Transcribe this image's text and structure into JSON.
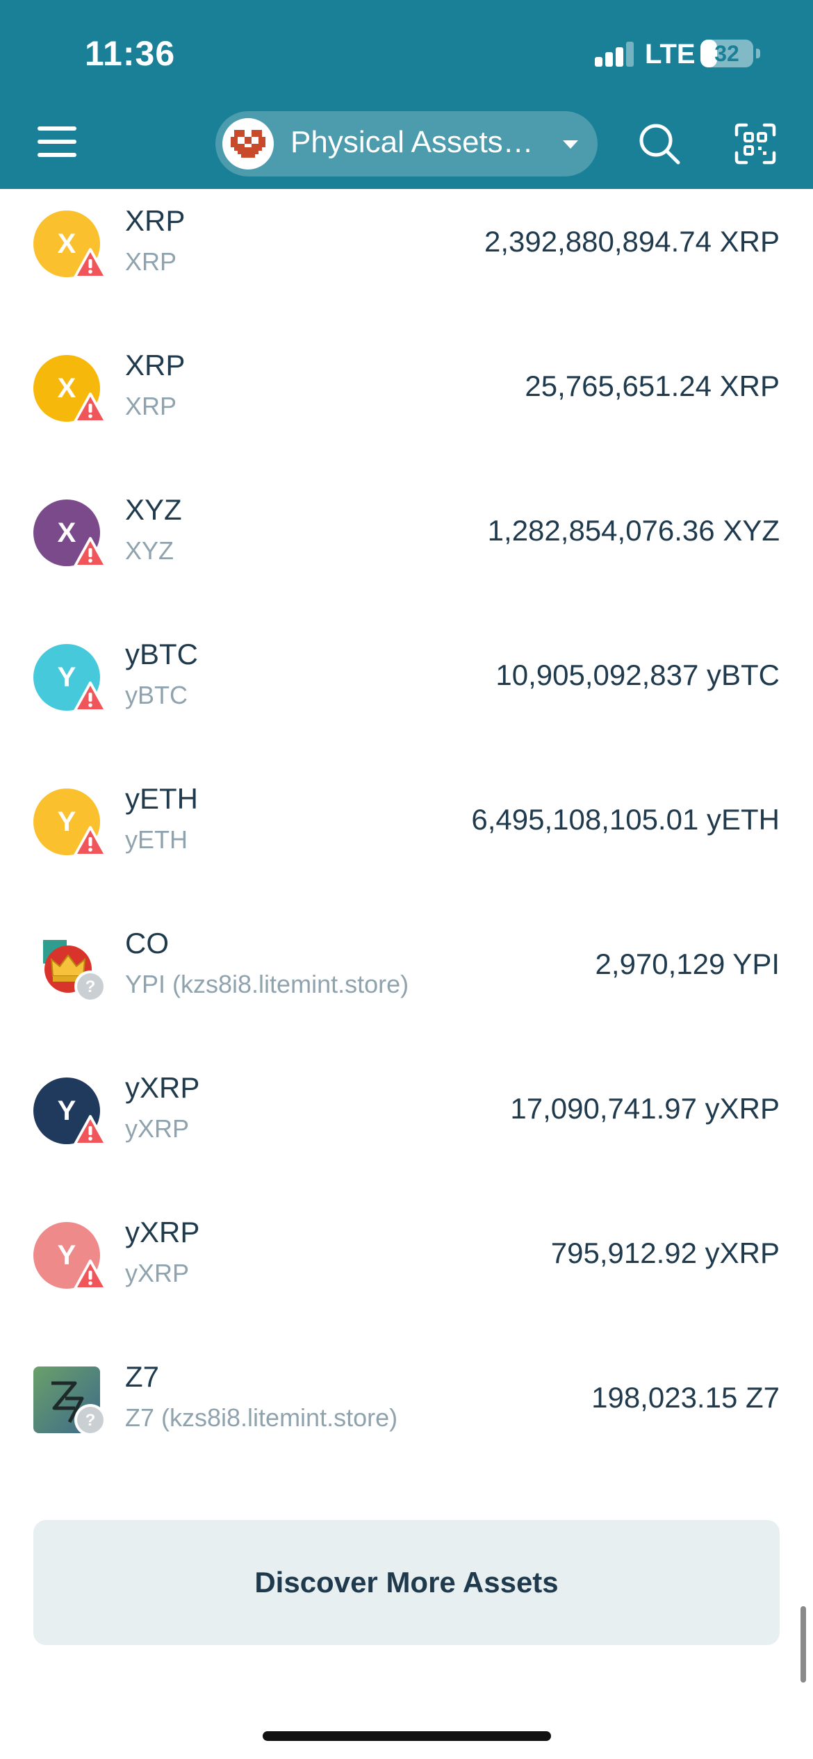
{
  "status_bar": {
    "time": "11:36",
    "network": "LTE",
    "battery": "32",
    "battery_level": 0.32
  },
  "header": {
    "account_name": "Physical Assets…",
    "menu_icon": "hamburger-menu-icon",
    "search_icon": "search-icon",
    "scan_icon": "qr-scan-icon",
    "background_color": "#1a8098"
  },
  "assets": [
    {
      "letter": "X",
      "name": "XRP",
      "sub": "XRP",
      "amount": "2,392,880,894.74 XRP",
      "color": "#fbc02d",
      "badge": "warning"
    },
    {
      "letter": "X",
      "name": "XRP",
      "sub": "XRP",
      "amount": "25,765,651.24 XRP",
      "color": "#f6b80a",
      "badge": "warning"
    },
    {
      "letter": "X",
      "name": "XYZ",
      "sub": "XYZ",
      "amount": "1,282,854,076.36 XYZ",
      "color": "#7b4a8b",
      "badge": "warning"
    },
    {
      "letter": "Y",
      "name": "yBTC",
      "sub": "yBTC",
      "amount": "10,905,092,837 yBTC",
      "color": "#47c9dc",
      "badge": "warning"
    },
    {
      "letter": "Y",
      "name": "yETH",
      "sub": "yETH",
      "amount": "6,495,108,105.01 yETH",
      "color": "#fbc02d",
      "badge": "warning"
    },
    {
      "letter": "",
      "name": "CO",
      "sub": "YPI (kzs8i8.litemint.store)",
      "amount": "2,970,129 YPI",
      "color": "#d9342b",
      "badge": "unknown",
      "icon": "crown-token-icon"
    },
    {
      "letter": "Y",
      "name": "yXRP",
      "sub": "yXRP",
      "amount": "17,090,741.97 yXRP",
      "color": "#1f3a5c",
      "badge": "warning"
    },
    {
      "letter": "Y",
      "name": "yXRP",
      "sub": "yXRP",
      "amount": "795,912.92 yXRP",
      "color": "#ef8a8a",
      "badge": "warning"
    },
    {
      "letter": "",
      "name": "Z7",
      "sub": "Z7 (kzs8i8.litemint.store)",
      "amount": "198,023.15 Z7",
      "color": "#5a8a6a",
      "badge": "unknown",
      "icon": "z7-token-icon"
    }
  ],
  "discover_button": "Discover More Assets",
  "colors": {
    "warning": "#f0555a",
    "unknown": "#c9cfd3",
    "text": "#1f3a4d",
    "subtext": "#8fa3ae"
  }
}
